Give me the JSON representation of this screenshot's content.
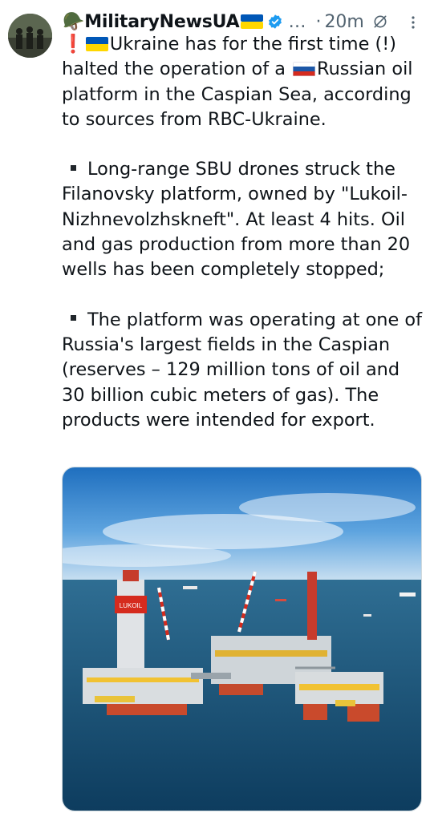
{
  "post": {
    "author_emoji": "🪖",
    "author_name": "MilitaryNewsUA",
    "ellipsis": "…",
    "separator": "·",
    "time": "20m",
    "icons": {
      "avatar": "avatar",
      "flag": "ukraine-flag-icon",
      "verified": "verified-badge-icon",
      "grok": "grok-icon",
      "more": "more-icon"
    }
  },
  "body": {
    "line1_exclaim": "❗",
    "line1_a": "Ukraine has for the first time (!) halted the operation of a ",
    "line1_b": "Russian oil platform in the Caspian Sea, according to sources from RBC-Ukraine.",
    "bullet1": "Long-range SBU drones struck the Filanovsky platform, owned by \"Lukoil-Nizhnevolzhskneft\". At least 4 hits. Oil and gas production from more than 20 wells has been completely stopped;",
    "bullet2": "The platform was operating at one of Russia's largest fields in the Caspian (reserves – 129 million tons of oil and 30 billion cubic meters of gas). The products were intended for export."
  },
  "media": {
    "label": "photo",
    "platform_sign": "LUKOIL"
  },
  "colors": {
    "text": "#0f1419",
    "secondary": "#536471",
    "verified": "#1d9bf0",
    "ukraine_blue": "#0057b7",
    "ukraine_yellow": "#ffd700"
  }
}
